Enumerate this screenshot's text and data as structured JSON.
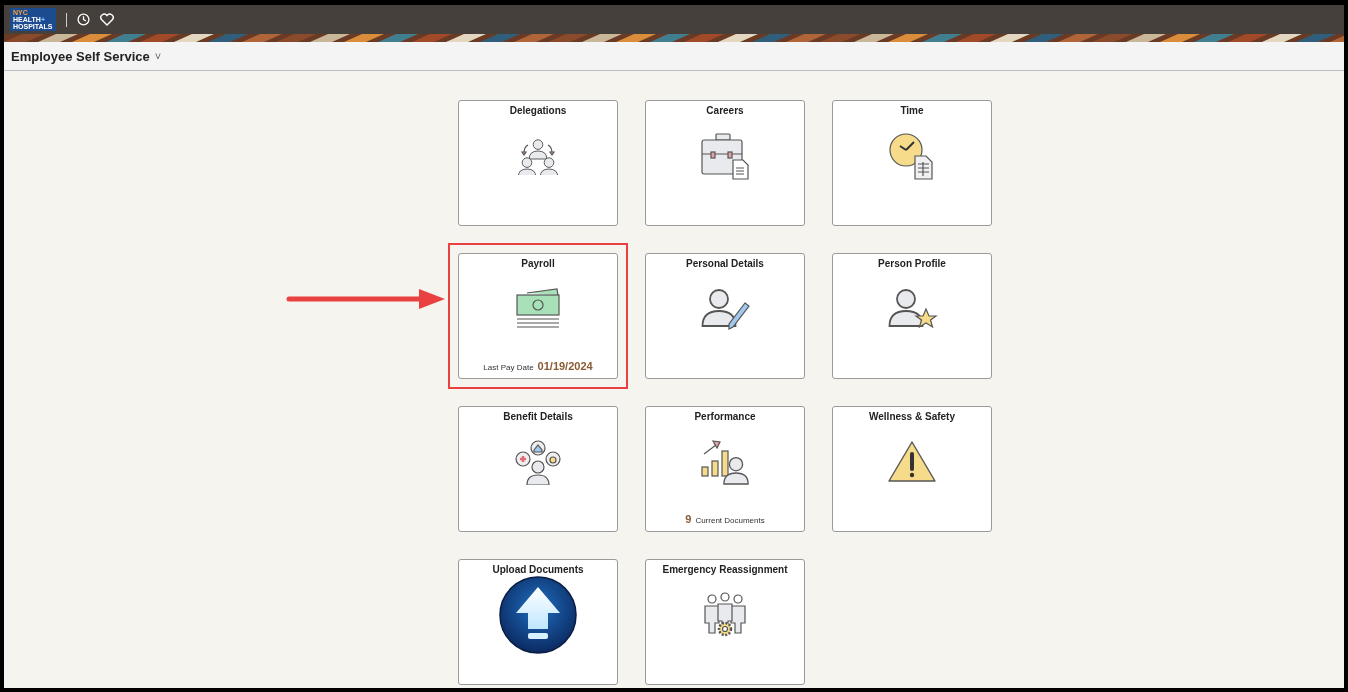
{
  "header": {
    "logo": {
      "lines": [
        "NYC",
        "HEALTH",
        "HOSPITALS"
      ],
      "plus": "+"
    }
  },
  "title_bar": {
    "title": "Employee Self Service",
    "caret": "˅"
  },
  "tiles": [
    {
      "title": "Delegations",
      "highlighted": false
    },
    {
      "title": "Careers",
      "highlighted": false
    },
    {
      "title": "Time",
      "highlighted": false
    },
    {
      "title": "Payroll",
      "highlighted": true,
      "footer": [
        {
          "kind": "label",
          "text": "Last Pay Date"
        },
        {
          "kind": "value",
          "text": "01/19/2024"
        }
      ]
    },
    {
      "title": "Personal Details",
      "highlighted": false
    },
    {
      "title": "Person Profile",
      "highlighted": false
    },
    {
      "title": "Benefit Details",
      "highlighted": false
    },
    {
      "title": "Performance",
      "highlighted": false,
      "footer": [
        {
          "kind": "value",
          "text": "9"
        },
        {
          "kind": "label",
          "text": "Current Documents"
        }
      ]
    },
    {
      "title": "Wellness & Safety",
      "highlighted": false
    },
    {
      "title": "Upload Documents",
      "highlighted": false
    },
    {
      "title": "Emergency Reassignment",
      "highlighted": false
    }
  ]
}
